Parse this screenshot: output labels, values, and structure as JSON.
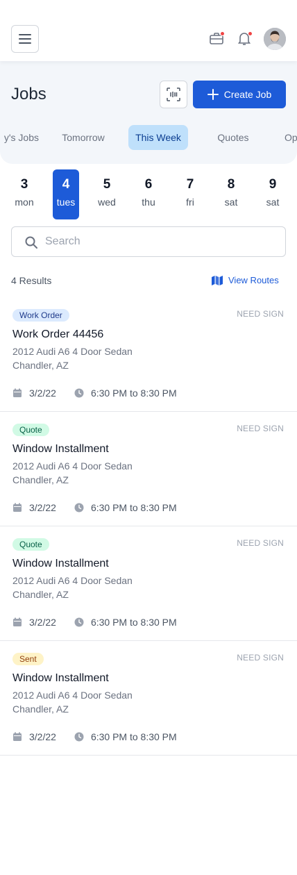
{
  "header": {
    "title": "Jobs",
    "create_label": "Create Job"
  },
  "tabs": [
    "y's Jobs",
    "Tomorrow",
    "This Week",
    "Quotes",
    "Op"
  ],
  "active_tab": "This Week",
  "days": [
    {
      "num": "3",
      "name": "mon"
    },
    {
      "num": "4",
      "name": "tues"
    },
    {
      "num": "5",
      "name": "wed"
    },
    {
      "num": "6",
      "name": "thu"
    },
    {
      "num": "7",
      "name": "fri"
    },
    {
      "num": "8",
      "name": "sat"
    },
    {
      "num": "9",
      "name": "sat"
    }
  ],
  "active_day": "4",
  "search": {
    "placeholder": "Search",
    "value": ""
  },
  "results_label": "4 Results",
  "view_routes_label": "View Routes",
  "colors": {
    "accent": "#1d5bd8",
    "active_tab_bg": "#bfe0fb",
    "notification_dot": "#ef4444",
    "badge_work_order_bg": "#dbeafe",
    "badge_quote_bg": "#d1fae5",
    "badge_sent_bg": "#fef3c7"
  },
  "icons": {
    "menu": "hamburger-menu-icon",
    "toolbox": "toolbox-icon",
    "bell": "bell-icon",
    "scan": "scan-icon",
    "add": "plus-icon",
    "search": "search-icon",
    "routes": "map-icon",
    "date": "calendar-icon",
    "time": "clock-icon"
  },
  "jobs": [
    {
      "badge": "Work Order",
      "badge_type": "work-order",
      "status": "NEED SIGN",
      "title": "Work Order 44456",
      "vehicle": "2012 Audi A6 4 Door Sedan",
      "location": "Chandler, AZ",
      "date": "3/2/22",
      "time": "6:30 PM to 8:30 PM"
    },
    {
      "badge": "Quote",
      "badge_type": "quote",
      "status": "NEED SIGN",
      "title": "Window Installment",
      "vehicle": "2012 Audi A6 4 Door Sedan",
      "location": "Chandler, AZ",
      "date": "3/2/22",
      "time": "6:30 PM to 8:30 PM"
    },
    {
      "badge": "Quote",
      "badge_type": "quote",
      "status": "NEED SIGN",
      "title": "Window Installment",
      "vehicle": "2012 Audi A6 4 Door Sedan",
      "location": "Chandler, AZ",
      "date": "3/2/22",
      "time": "6:30 PM to 8:30 PM"
    },
    {
      "badge": "Sent",
      "badge_type": "sent",
      "status": "NEED SIGN",
      "title": "Window Installment",
      "vehicle": "2012 Audi A6 4 Door Sedan",
      "location": "Chandler, AZ",
      "date": "3/2/22",
      "time": "6:30 PM to 8:30 PM"
    }
  ]
}
